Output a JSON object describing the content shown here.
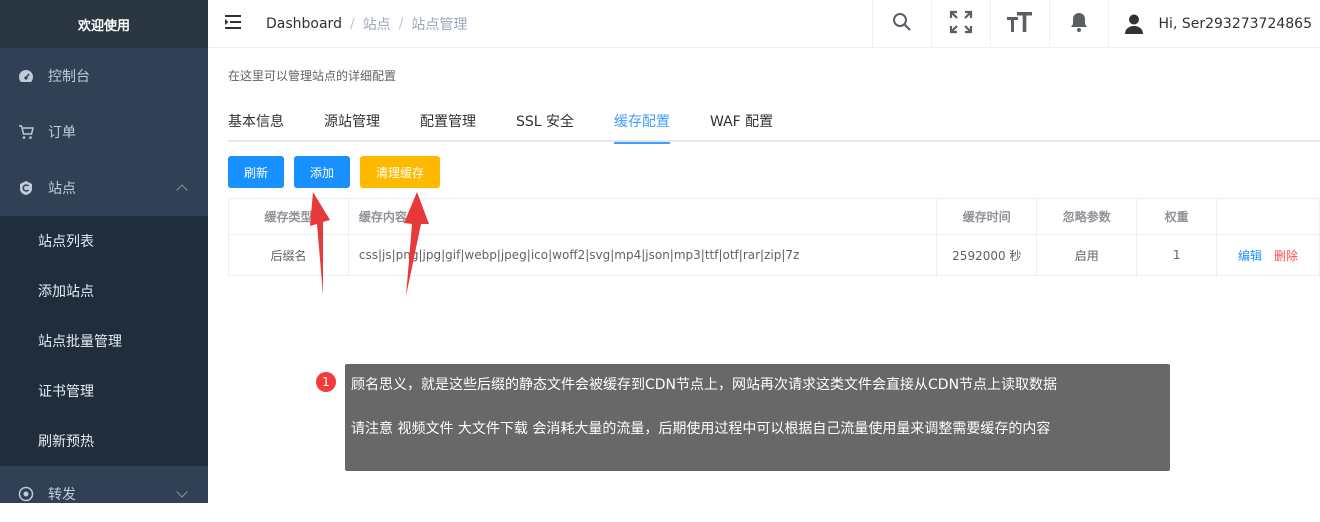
{
  "sidebar": {
    "brand": "欢迎使用",
    "items": [
      {
        "label": "控制台",
        "icon": "dashboard-icon"
      },
      {
        "label": "订单",
        "icon": "cart-icon"
      },
      {
        "label": "站点",
        "icon": "site-icon",
        "expanded": true,
        "children": [
          "站点列表",
          "添加站点",
          "站点批量管理",
          "证书管理",
          "刷新预热"
        ]
      },
      {
        "label": "转发",
        "icon": "forward-icon",
        "expanded": false
      }
    ]
  },
  "header": {
    "breadcrumb": [
      "Dashboard",
      "站点",
      "站点管理"
    ],
    "user": "Hi, Ser293273724865",
    "icons": [
      "search-icon",
      "fullscreen-icon",
      "font-size-icon",
      "bell-icon",
      "user-icon"
    ]
  },
  "main": {
    "description": "在这里可以管理站点的详细配置",
    "tabs": [
      "基本信息",
      "源站管理",
      "配置管理",
      "SSL 安全",
      "缓存配置",
      "WAF 配置"
    ],
    "active_tab": "缓存配置",
    "buttons": {
      "refresh": "刷新",
      "add": "添加",
      "purge": "清理缓存"
    },
    "table": {
      "headers": [
        "缓存类型",
        "缓存内容",
        "缓存时间",
        "忽略参数",
        "权重",
        ""
      ],
      "rows": [
        {
          "type": "后缀名",
          "content": "css|js|png|jpg|gif|webp|jpeg|ico|woff2|svg|mp4|json|mp3|ttf|otf|rar|zip|7z",
          "time": "2592000 秒",
          "ignore": "启用",
          "weight": "1",
          "edit": "编辑",
          "delete": "删除"
        }
      ]
    }
  },
  "annotation": {
    "badge": "1",
    "line1": "顾名思义，就是这些后缀的静态文件会被缓存到CDN节点上，网站再次请求这类文件会直接从CDN节点上读取数据",
    "line2": "请注意  视频文件  大文件下载 会消耗大量的流量，后期使用过程中可以根据自己流量使用量来调整需要缓存的内容"
  },
  "colors": {
    "sidebar": "#304156",
    "accent": "#1890ff",
    "warning": "#ffba00",
    "danger": "#ff4d4f",
    "arrow": "#e8393a"
  }
}
